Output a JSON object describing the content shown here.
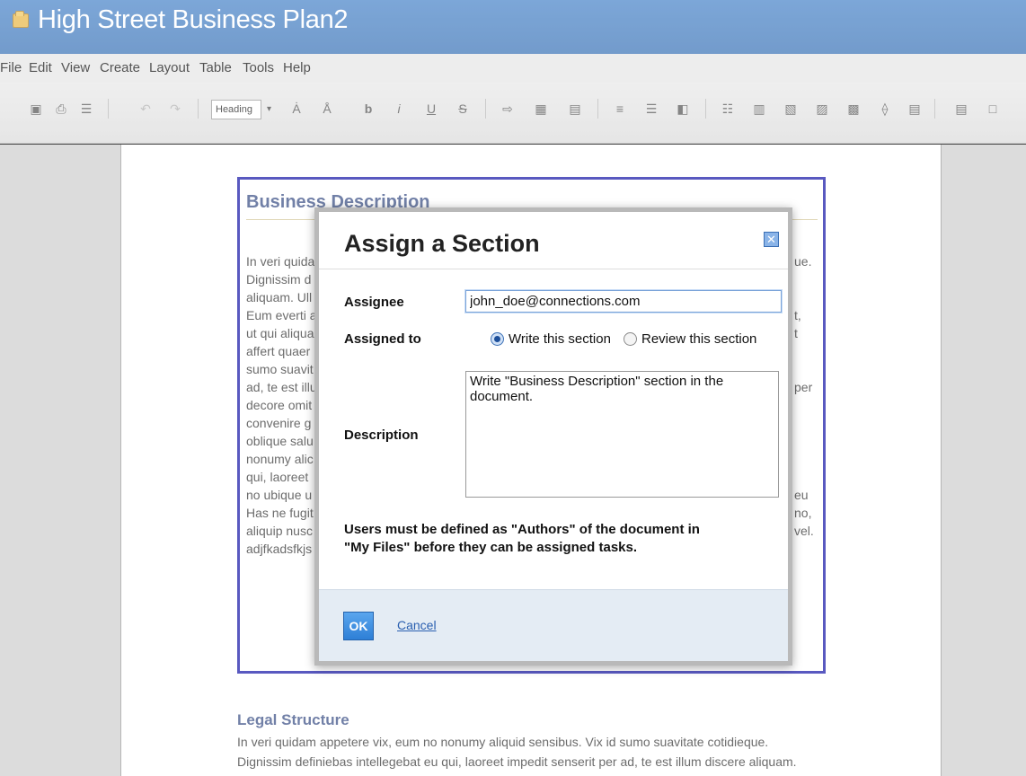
{
  "window": {
    "title": "High Street Business Plan2"
  },
  "menu": [
    "File",
    "Edit",
    "View",
    "Create",
    "Layout",
    "Table",
    "Tools",
    "Help"
  ],
  "toolbar": {
    "heading_select": "Heading"
  },
  "document": {
    "section_heading": "Business Description",
    "left_lines": [
      "In veri quida",
      "Dignissim d",
      "aliquam. Ull",
      "Eum everti a",
      "ut qui aliqua",
      "affert quaer",
      "sumo suavit",
      "ad, te est illu",
      "decore omit",
      "convenire g",
      "oblique salu",
      "nonumy alic",
      "qui, laoreet",
      "no ubique u",
      "Has ne fugit",
      "aliquip nusc",
      "adjfkadsfkjs"
    ],
    "right_fragments": [
      "ue.",
      "t,",
      "t",
      "per",
      "eu",
      "no,",
      "vel."
    ],
    "legal_heading": "Legal Structure",
    "legal_lines": [
      "In veri quidam appetere vix, eum no nonumy aliquid sensibus. Vix id sumo suavitate cotidieque.",
      "Dignissim definiebas intellegebat eu qui, laoreet impedit senserit per ad, te est illum discere aliquam."
    ]
  },
  "dialog": {
    "title": "Assign a Section",
    "close_icon": "close-icon",
    "assignee_label": "Assignee",
    "assignee_value": "john_doe@connections.com",
    "assigned_to_label": "Assigned to",
    "option_write": "Write this section",
    "option_review": "Review this section",
    "selected_option": "write",
    "description_label": "Description",
    "description_value": "Write \"Business Description\" section in the document.",
    "note_line1": "Users must be defined as \"Authors\" of the document in",
    "note_line2": "\"My Files\" before they can be assigned tasks.",
    "ok_label": "OK",
    "cancel_label": "Cancel"
  }
}
